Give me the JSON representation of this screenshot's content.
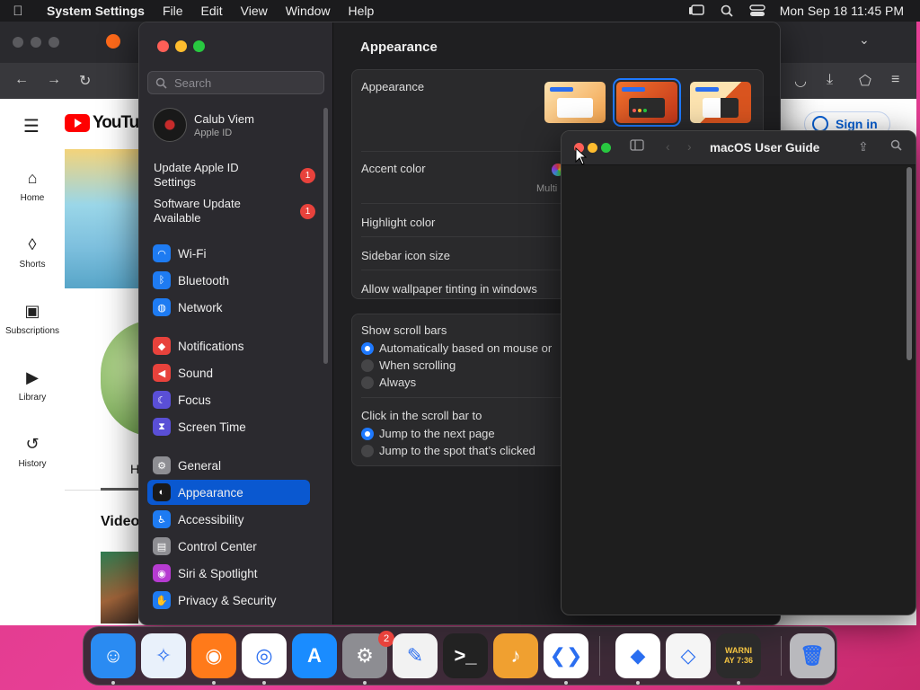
{
  "menubar": {
    "app_name": "System Settings",
    "items": [
      "File",
      "Edit",
      "View",
      "Window",
      "Help"
    ],
    "clock": "Mon Sep 18  11:45 PM"
  },
  "browser": {
    "youtube_logo": "YouTube",
    "sign_in": "Sign in",
    "sidebar": [
      "Home",
      "Shorts",
      "Subscriptions",
      "Library",
      "History"
    ],
    "partial_heading": "H",
    "videos_label": "Video"
  },
  "settings": {
    "search_placeholder": "Search",
    "profile": {
      "name": "Calub Viem",
      "subtitle": "Apple ID"
    },
    "notices": [
      {
        "label": "Update Apple ID Settings",
        "badge": "1"
      },
      {
        "label": "Software Update Available",
        "badge": "1"
      }
    ],
    "sidebar_items": [
      {
        "label": "Wi-Fi",
        "icon": "wifi-icon",
        "color": "#1e7bf2",
        "glyph": "◠"
      },
      {
        "label": "Bluetooth",
        "icon": "bluetooth-icon",
        "color": "#1e7bf2",
        "glyph": "ᛒ"
      },
      {
        "label": "Network",
        "icon": "globe-icon",
        "color": "#1e7bf2",
        "glyph": "◍"
      },
      {
        "label": "Notifications",
        "icon": "bell-icon",
        "color": "#e8423c",
        "glyph": "◆"
      },
      {
        "label": "Sound",
        "icon": "speaker-icon",
        "color": "#e8423c",
        "glyph": "◀"
      },
      {
        "label": "Focus",
        "icon": "moon-icon",
        "color": "#5a4fd6",
        "glyph": "☾"
      },
      {
        "label": "Screen Time",
        "icon": "hourglass-icon",
        "color": "#5a4fd6",
        "glyph": "⧗"
      },
      {
        "label": "General",
        "icon": "gear-icon",
        "color": "#8e8e93",
        "glyph": "⚙"
      },
      {
        "label": "Appearance",
        "icon": "appearance-icon",
        "color": "#1a1a1a",
        "glyph": "◐"
      },
      {
        "label": "Accessibility",
        "icon": "accessibility-icon",
        "color": "#1e7bf2",
        "glyph": "♿"
      },
      {
        "label": "Control Center",
        "icon": "control-center-icon",
        "color": "#8e8e93",
        "glyph": "▤"
      },
      {
        "label": "Siri & Spotlight",
        "icon": "siri-icon",
        "color": "#b63bd1",
        "glyph": "◉"
      },
      {
        "label": "Privacy & Security",
        "icon": "hand-icon",
        "color": "#1e7bf2",
        "glyph": "✋"
      }
    ],
    "active_item": "Appearance",
    "content": {
      "title": "Appearance",
      "appearance_label": "Appearance",
      "accent_label": "Accent color",
      "accent_caption": "Multi",
      "highlight_label": "Highlight color",
      "sidebar_icon_label": "Sidebar icon size",
      "tinting_label": "Allow wallpaper tinting in windows",
      "scroll_title": "Show scroll bars",
      "scroll_options": [
        "Automatically based on mouse or",
        "When scrolling",
        "Always"
      ],
      "scroll_selected": 0,
      "click_title": "Click in the scroll bar to",
      "click_options": [
        "Jump to the next page",
        "Jump to the spot that’s clicked"
      ],
      "click_selected": 0
    }
  },
  "guide": {
    "title": "macOS User Guide"
  },
  "dock": {
    "apps": [
      {
        "name": "finder",
        "color": "#2a8bf2",
        "glyph": "☺"
      },
      {
        "name": "safari",
        "color": "#e9f1fb",
        "glyph": "✧"
      },
      {
        "name": "firefox",
        "color": "#ff7a1a",
        "glyph": "◉"
      },
      {
        "name": "chrome",
        "color": "#ffffff",
        "glyph": "◎"
      },
      {
        "name": "app-store",
        "color": "#1a8cff",
        "glyph": "A"
      },
      {
        "name": "system-settings",
        "color": "#8d8d92",
        "glyph": "⚙"
      },
      {
        "name": "textedit",
        "color": "#f2f2f2",
        "glyph": "✎"
      },
      {
        "name": "terminal",
        "color": "#222222",
        "glyph": ">_"
      },
      {
        "name": "garageband",
        "color": "#f0a030",
        "glyph": "♪"
      },
      {
        "name": "vscode",
        "color": "#ffffff",
        "glyph": "❮❯"
      },
      {
        "name": "visual-studio",
        "color": "#ffffff",
        "glyph": "◆"
      },
      {
        "name": "sketch-like",
        "color": "#f5f5f5",
        "glyph": "◇"
      },
      {
        "name": "console",
        "color": "#2b2b2b",
        "glyph": "!"
      },
      {
        "name": "trash",
        "color": "#b9b9bd",
        "glyph": "🗑"
      }
    ],
    "settings_badge": "2",
    "console_text": "WARNI\nAY 7:36"
  }
}
